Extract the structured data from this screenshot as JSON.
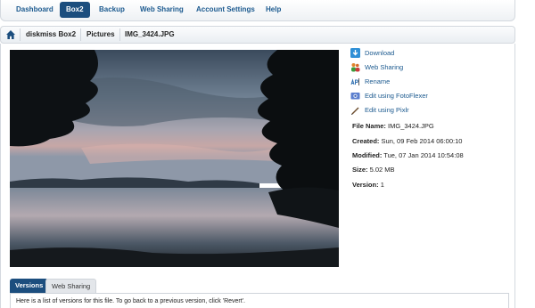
{
  "nav": {
    "items": [
      {
        "label": "Dashboard",
        "active": false
      },
      {
        "label": "Box2",
        "active": true
      },
      {
        "label": "Backup",
        "active": false
      },
      {
        "label": "Web Sharing",
        "active": false
      },
      {
        "label": "Account Settings",
        "active": false
      },
      {
        "label": "Help",
        "active": false
      }
    ]
  },
  "breadcrumb": {
    "home_icon": "home-icon",
    "items": [
      "diskmiss Box2",
      "Pictures",
      "IMG_3424.JPG"
    ]
  },
  "actions": [
    {
      "label": "Download",
      "icon": "download-icon"
    },
    {
      "label": "Web Sharing",
      "icon": "users-icon"
    },
    {
      "label": "Rename",
      "icon": "rename-icon"
    },
    {
      "label": "Edit using FotoFlexer",
      "icon": "fotoflexer-icon"
    },
    {
      "label": "Edit using Pixlr",
      "icon": "pencil-icon"
    }
  ],
  "file_info": {
    "name_label": "File Name:",
    "name_value": "IMG_3424.JPG",
    "created_label": "Created:",
    "created_value": "Sun, 09 Feb 2014 06:00:10",
    "modified_label": "Modified:",
    "modified_value": "Tue, 07 Jan 2014 10:54:08",
    "size_label": "Size:",
    "size_value": "5.02 MB",
    "version_label": "Version:",
    "version_value": "1"
  },
  "tabs": {
    "items": [
      "Versions",
      "Web Sharing"
    ],
    "active_index": 0,
    "body_text": "Here is a list of versions for this file. To go back to a previous version, click 'Revert'."
  },
  "colors": {
    "accent": "#1c4e7e",
    "link": "#1c5a8f"
  }
}
